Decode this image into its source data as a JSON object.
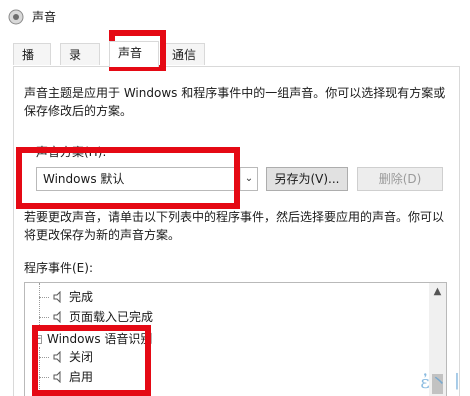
{
  "window": {
    "title": "声音"
  },
  "tabs": [
    {
      "label": "播放"
    },
    {
      "label": "录制"
    },
    {
      "label": "声音"
    },
    {
      "label": "通信"
    }
  ],
  "sound_tab": {
    "description": "声音主题是应用于 Windows 和程序事件中的一组声音。你可以选择现有方案或保存修改后的方案。",
    "scheme_label": "声音方案(H):",
    "scheme_value": "Windows 默认",
    "save_as_label": "另存为(V)...",
    "delete_label": "删除(D)",
    "change_description": "若要更改声音，请单击以下列表中的程序事件，然后选择要应用的声音。你可以将更改保存为新的声音方案。",
    "events_label": "程序事件(E):",
    "events": [
      {
        "label": "完成"
      },
      {
        "label": "页面载入已完成"
      }
    ],
    "group_label": "Windows 语音识别",
    "group_expander": "−",
    "group_events": [
      {
        "label": "关闭"
      },
      {
        "label": "启用"
      }
    ]
  },
  "annotation_color": "#e50914",
  "icons": {
    "app": "speaker-icon",
    "event": "speaker-icon",
    "scroll_up": "▲",
    "combo_arrow": "⌄"
  },
  "watermark": "ἐ丶丨"
}
